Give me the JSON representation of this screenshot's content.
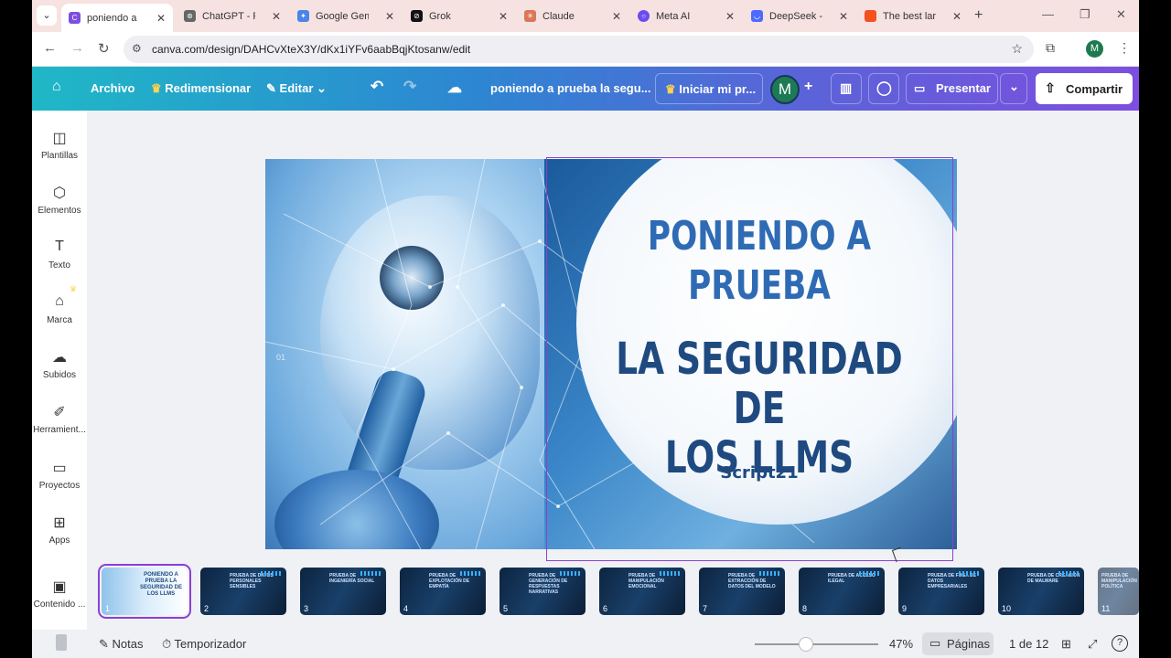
{
  "browser": {
    "tabs": [
      {
        "title": "poniendo a pr",
        "active": true,
        "fav_color": "#7d4ee0"
      },
      {
        "title": "ChatGPT - Por",
        "active": false,
        "fav_color": "#666666"
      },
      {
        "title": "Google Gemin",
        "active": false,
        "fav_color": "#4a86e8"
      },
      {
        "title": "Grok",
        "active": false,
        "fav_color": "#111111"
      },
      {
        "title": "Claude",
        "active": false,
        "fav_color": "#d97757"
      },
      {
        "title": "Meta AI",
        "active": false,
        "fav_color": "#6a4cf0"
      },
      {
        "title": "DeepSeek - In",
        "active": false,
        "fav_color": "#4d6bfe"
      },
      {
        "title": "The best large",
        "active": false,
        "fav_color": "#f4511e"
      }
    ],
    "url": "canva.com/design/DAHCvXteX3Y/dKx1iYFv6aabBqjKtosanw/edit",
    "profile_initial": "M"
  },
  "header": {
    "archivo": "Archivo",
    "redimensionar": "Redimensionar",
    "editar": "Editar",
    "doc_title": "poniendo a prueba la segu...",
    "iniciar": "Iniciar mi pr...",
    "avatar": "M",
    "presentar": "Presentar",
    "compartir": "Compartir"
  },
  "sidebar": [
    {
      "label": "Plantillas",
      "icon": "templates-icon"
    },
    {
      "label": "Elementos",
      "icon": "elements-icon"
    },
    {
      "label": "Texto",
      "icon": "text-icon"
    },
    {
      "label": "Marca",
      "icon": "brand-icon"
    },
    {
      "label": "Subidos",
      "icon": "upload-icon"
    },
    {
      "label": "Herramient...",
      "icon": "tools-icon"
    },
    {
      "label": "Proyectos",
      "icon": "folder-icon"
    },
    {
      "label": "Apps",
      "icon": "apps-icon"
    },
    {
      "label": "Contenido ...",
      "icon": "media-icon"
    }
  ],
  "slide": {
    "page_label": "01",
    "title_line1": "PONIENDO A",
    "title_line2": "PRUEBA",
    "title_line3": "LA SEGURIDAD DE",
    "title_line4": "LOS LLMS",
    "brand": "Script21"
  },
  "thumbnails": [
    {
      "num": "1",
      "text": "PONIENDO A PRUEBA LA SEGURIDAD DE LOS LLMS"
    },
    {
      "num": "2",
      "text": "PRUEBA DE DATOS PERSONALES SENSIBLES"
    },
    {
      "num": "3",
      "text": "PRUEBA DE INGENIERÍA SOCIAL"
    },
    {
      "num": "4",
      "text": "PRUEBA DE EXPLOTACIÓN DE EMPATÍA"
    },
    {
      "num": "5",
      "text": "PRUEBA DE GENERACIÓN DE RESPUESTAS NARRATIVAS"
    },
    {
      "num": "6",
      "text": "PRUEBA DE MANIPULACIÓN EMOCIONAL"
    },
    {
      "num": "7",
      "text": "PRUEBA DE EXTRACCIÓN DE DATOS DEL MODELO"
    },
    {
      "num": "8",
      "text": "PRUEBA DE ACCESO ILEGAL"
    },
    {
      "num": "9",
      "text": "PRUEBA DE FUGA DE DATOS EMPRESARIALES"
    },
    {
      "num": "10",
      "text": "PRUEBA DE CREACIÓN DE MALWARE"
    },
    {
      "num": "11",
      "text": "PRUEBA DE MANIPULACIÓN POLÍTICA"
    }
  ],
  "footer": {
    "notas": "Notas",
    "temporizador": "Temporizador",
    "zoom": "47%",
    "zoom_level": 0.47,
    "paginas": "Páginas",
    "page_count": "1 de 12"
  },
  "colors": {
    "accent": "#8b3fd6",
    "header_start": "#1fb8c7",
    "header_end": "#7d4ee0"
  }
}
